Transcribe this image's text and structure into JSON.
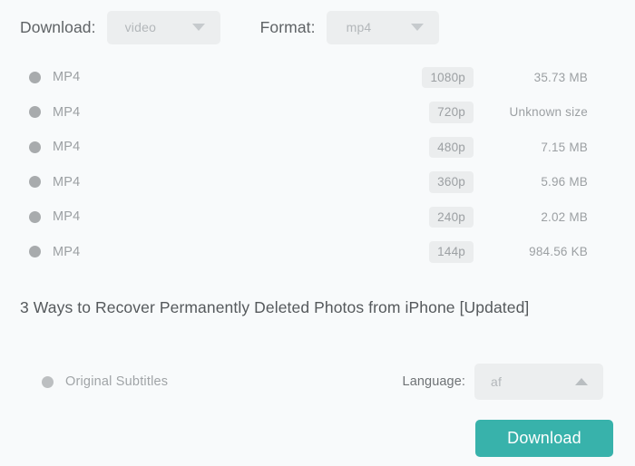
{
  "controls": {
    "download_label": "Download:",
    "download_select": {
      "value": "video",
      "icon": "chevron-down-icon"
    },
    "format_label": "Format:",
    "format_select": {
      "value": "mp4",
      "icon": "chevron-down-icon"
    }
  },
  "formats": [
    {
      "name": "MP4",
      "quality": "1080p",
      "size": "35.73 MB"
    },
    {
      "name": "MP4",
      "quality": "720p",
      "size": "Unknown size"
    },
    {
      "name": "MP4",
      "quality": "480p",
      "size": "7.15 MB"
    },
    {
      "name": "MP4",
      "quality": "360p",
      "size": "5.96 MB"
    },
    {
      "name": "MP4",
      "quality": "240p",
      "size": "2.02 MB"
    },
    {
      "name": "MP4",
      "quality": "144p",
      "size": "984.56 KB"
    }
  ],
  "video": {
    "title": "3 Ways to Recover Permanently Deleted Photos from iPhone [Updated]"
  },
  "subtitles": {
    "option_label": "Original Subtitles",
    "language_label": "Language:",
    "language_value": "af",
    "language_icon": "chevron-up-icon"
  },
  "actions": {
    "download_button": "Download"
  },
  "colors": {
    "page_background": "#f8fafb",
    "accent_teal": "#38b2ab",
    "control_fill": "#eceeef",
    "badge_fill": "#ebedee",
    "muted_text": "#9ca0a3",
    "label_text": "#5f6366",
    "radio_fill": "#a8abad"
  }
}
